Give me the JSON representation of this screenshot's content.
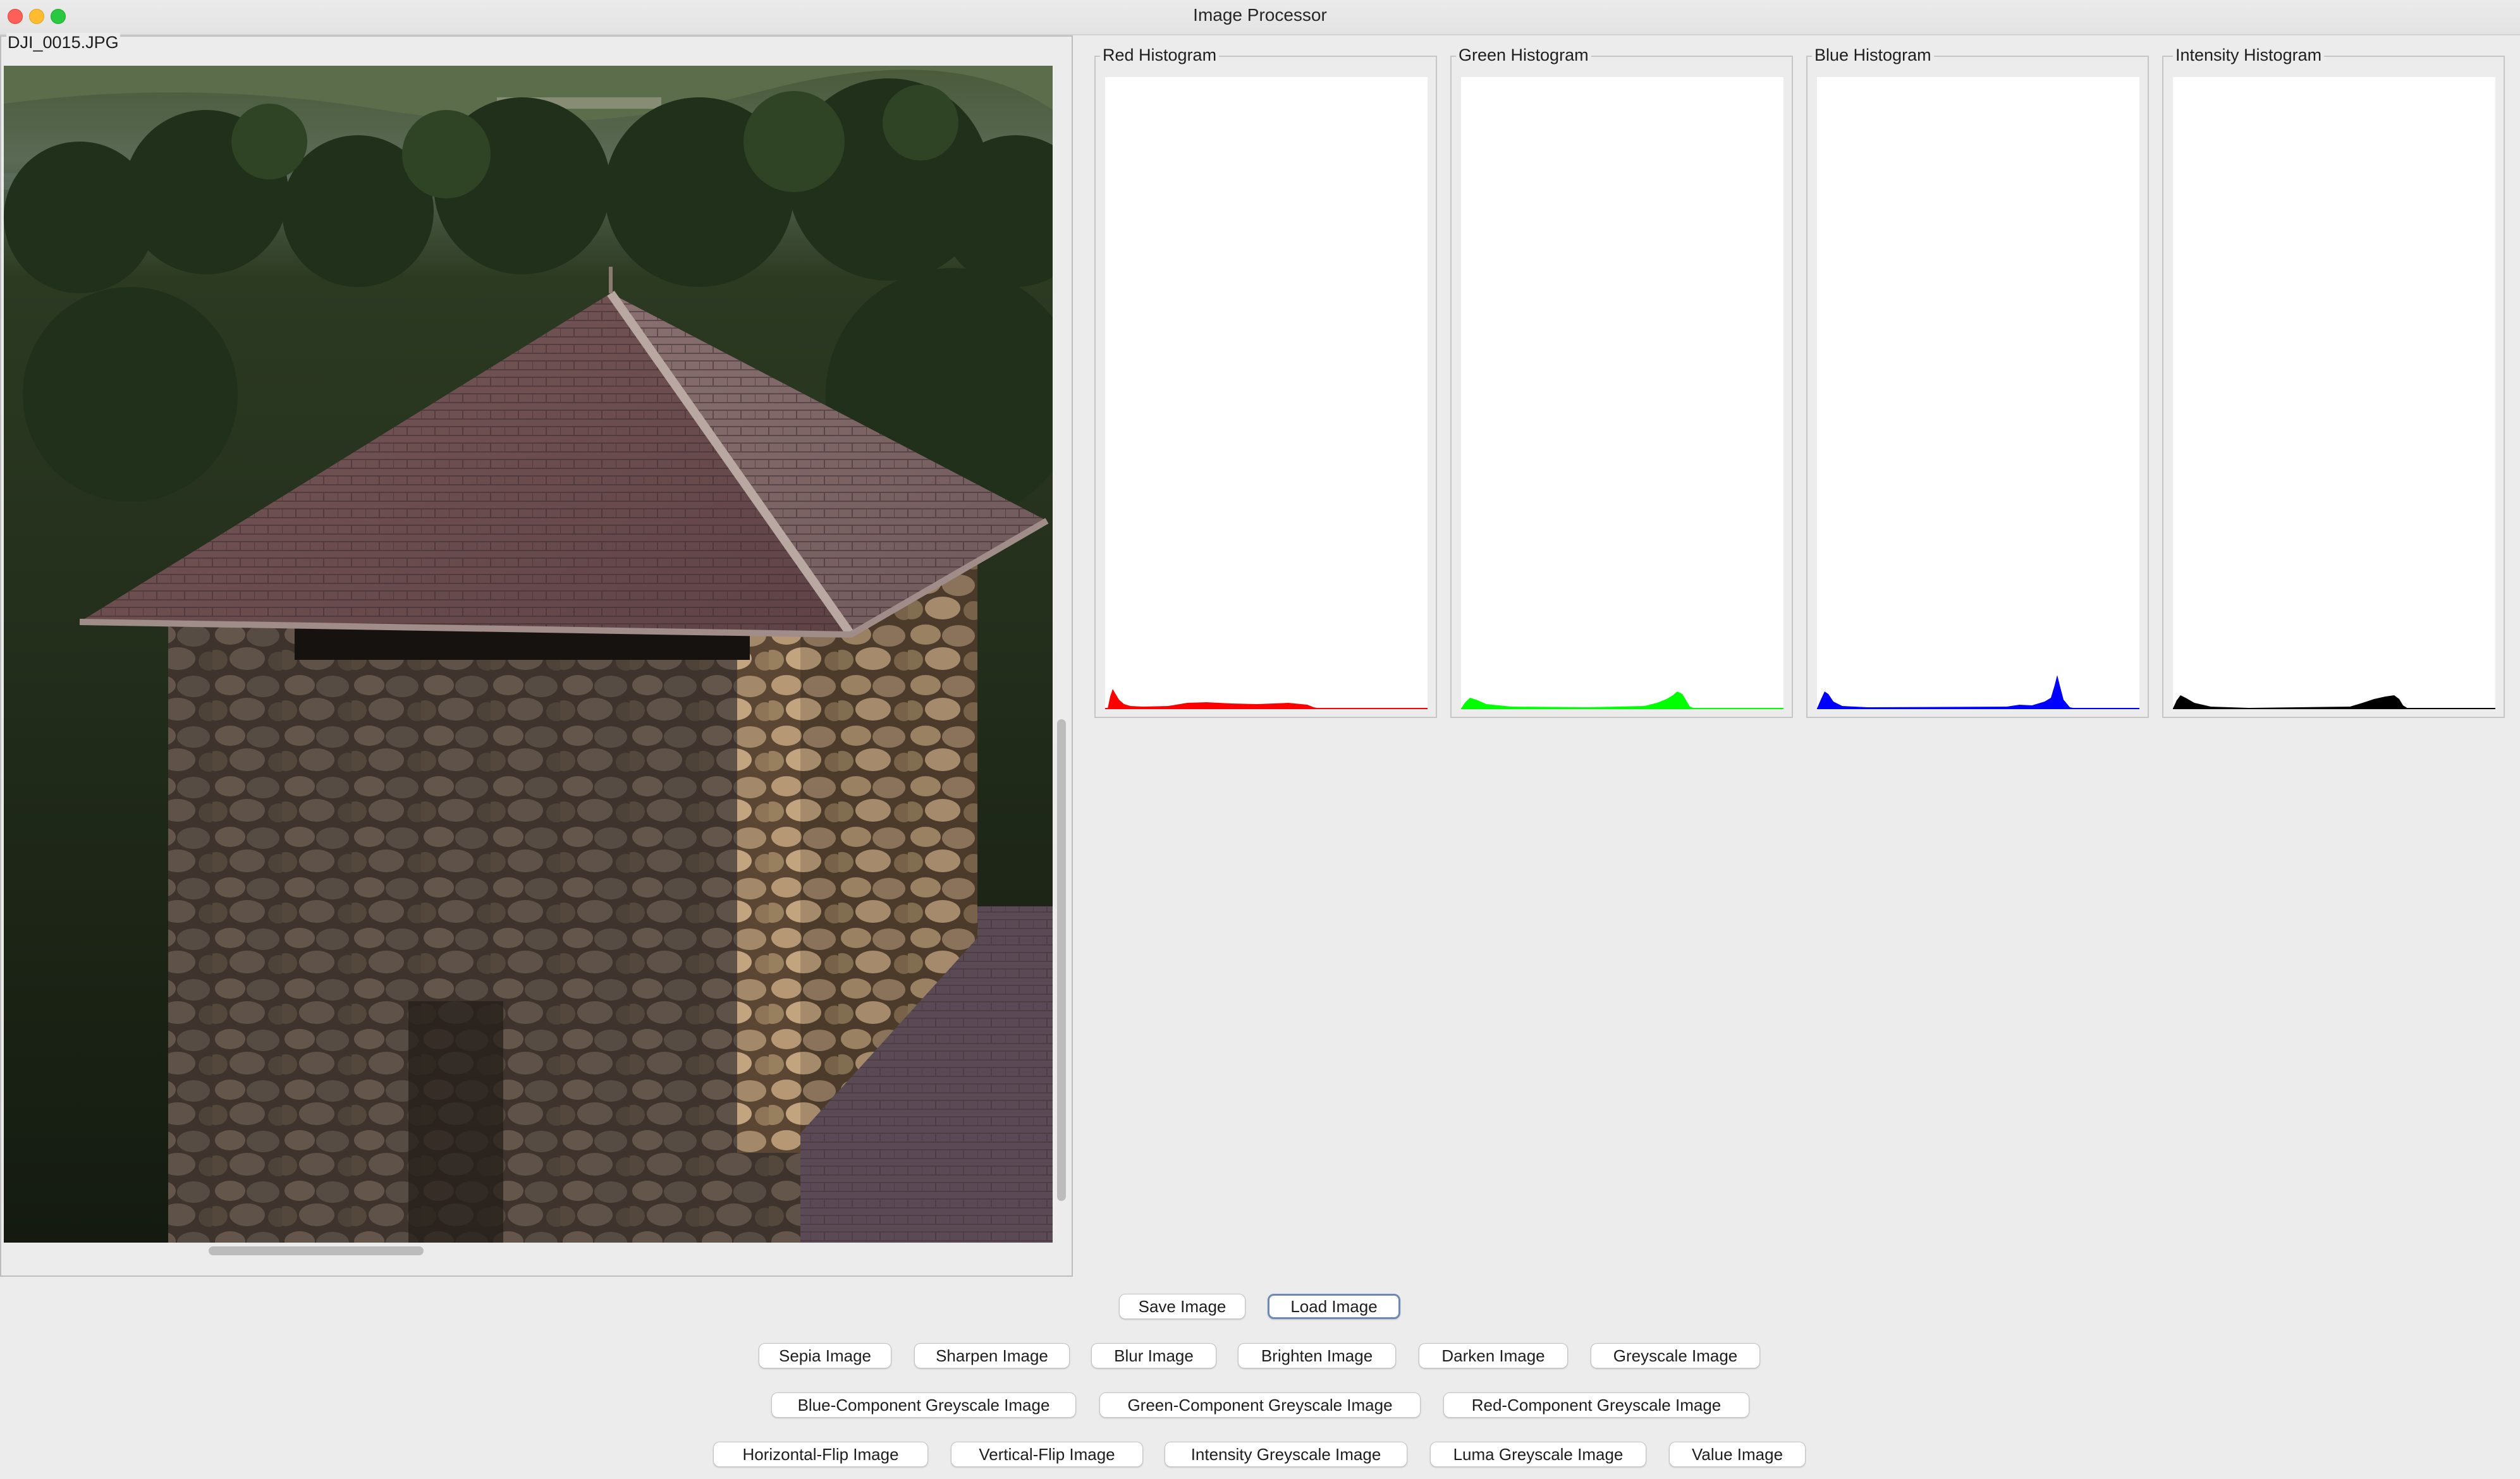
{
  "window": {
    "title": "Image Processor"
  },
  "image_panel": {
    "filename": "DJI_0015.JPG"
  },
  "histograms": [
    {
      "title": "Red Histogram",
      "color": "#ff0000"
    },
    {
      "title": "Green Histogram",
      "color": "#00ff00"
    },
    {
      "title": "Blue Histogram",
      "color": "#0000ff"
    },
    {
      "title": "Intensity Histogram",
      "color": "#000000"
    }
  ],
  "buttons": {
    "save": "Save Image",
    "load": "Load Image",
    "sepia": "Sepia Image",
    "sharpen": "Sharpen Image",
    "blur": "Blur Image",
    "brighten": "Brighten Image",
    "darken": "Darken Image",
    "greyscale": "Greyscale Image",
    "blue_component": "Blue-Component Greyscale Image",
    "green_component": "Green-Component Greyscale Image",
    "red_component": "Red-Component Greyscale Image",
    "horizontal_flip": "Horizontal-Flip Image",
    "vertical_flip": "Vertical-Flip Image",
    "intensity_greyscale": "Intensity Greyscale Image",
    "luma_greyscale": "Luma Greyscale Image",
    "value": "Value Image"
  }
}
